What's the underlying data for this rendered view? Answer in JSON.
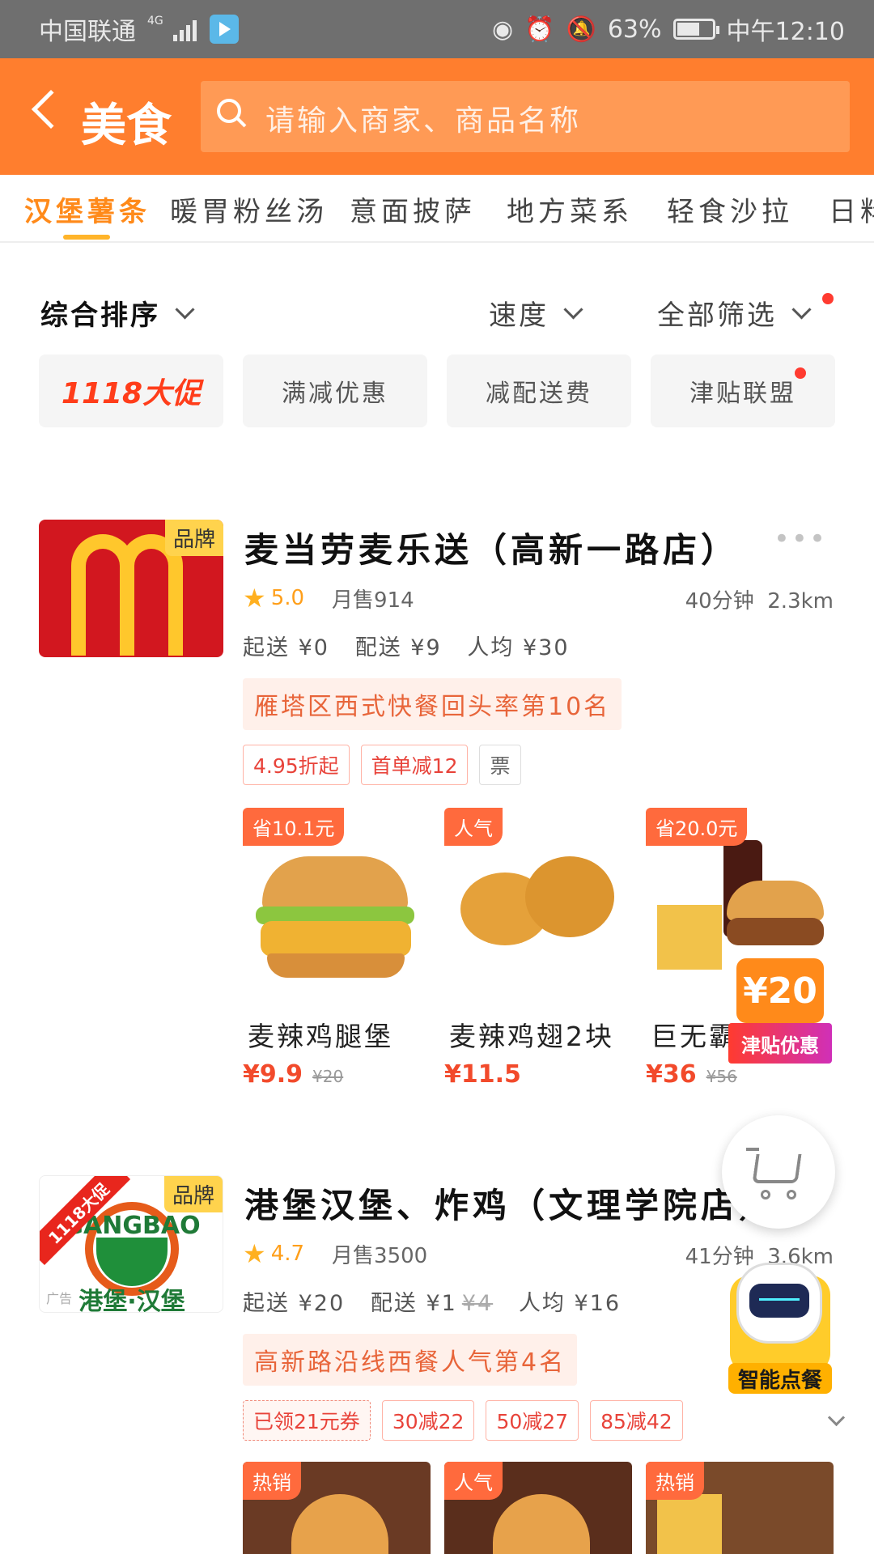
{
  "status_bar": {
    "carrier": "中国联通",
    "network": "4G",
    "battery": "63%",
    "time": "中午12:10"
  },
  "header": {
    "title": "美食",
    "search_placeholder": "请输入商家、商品名称"
  },
  "categories": [
    {
      "label": "汉堡薯条",
      "active": true
    },
    {
      "label": "暖胃粉丝汤",
      "active": false
    },
    {
      "label": "意面披萨",
      "active": false
    },
    {
      "label": "地方菜系",
      "active": false
    },
    {
      "label": "轻食沙拉",
      "active": false
    },
    {
      "label": "日料",
      "active": false
    }
  ],
  "sort": {
    "comprehensive": "综合排序",
    "speed": "速度",
    "all_filters": "全部筛选"
  },
  "filter_chips": [
    "1118大促",
    "满减优惠",
    "减配送费",
    "津贴联盟"
  ],
  "stores": [
    {
      "name": "麦当劳麦乐送（高新一路店）",
      "brand_tag": "品牌",
      "rating": "5.0",
      "monthly_sales": "月售914",
      "time": "40分钟",
      "distance": "2.3km",
      "min_order": "起送 ¥0",
      "delivery": "配送 ¥9",
      "delivery_orig": "",
      "per_capita": "人均 ¥30",
      "rank": "雁塔区西式快餐回头率第10名",
      "tags": [
        "4.95折起",
        "首单减12",
        "票"
      ],
      "dishes": [
        {
          "badge": "省10.1元",
          "name": "麦辣鸡腿堡",
          "price": "¥9.9",
          "orig": "¥20"
        },
        {
          "badge": "人气",
          "name": "麦辣鸡翅2块",
          "price": "¥11.5",
          "orig": ""
        },
        {
          "badge": "省20.0元",
          "name": "巨无霸",
          "price": "¥36",
          "orig": "¥56"
        }
      ]
    },
    {
      "name": "港堡汉堡、炸鸡（文理学院店）",
      "brand_tag": "品牌",
      "logo_en": "GANGBAO",
      "logo_cn": "港堡·汉堡",
      "promo_ribbon": "1118大促",
      "ad_tag": "广告",
      "rating": "4.7",
      "monthly_sales": "月售3500",
      "time": "41分钟",
      "distance": "3.6km",
      "min_order": "起送 ¥20",
      "delivery": "配送 ¥1",
      "delivery_orig": "¥4",
      "per_capita": "人均 ¥16",
      "rank": "高新路沿线西餐人气第4名",
      "tags": [
        "已领21元券",
        "30减22",
        "50减27",
        "85减42"
      ],
      "dish_badges": [
        "热销",
        "人气",
        "热销"
      ]
    }
  ],
  "floating": {
    "subsidy_amount": "¥20",
    "subsidy_label": "津贴优惠",
    "robot_label": "智能点餐"
  },
  "colors": {
    "header_orange": "#ff7e2e",
    "price_red": "#f24a2b",
    "active_tab": "#ff8a1a"
  }
}
